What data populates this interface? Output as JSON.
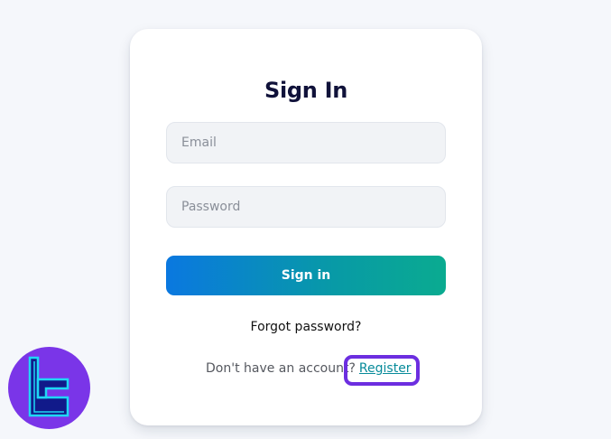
{
  "signin_form": {
    "title": "Sign In",
    "email_placeholder": "Email",
    "password_placeholder": "Password",
    "submit_label": "Sign in",
    "forgot_password": "Forgot password?",
    "register_prompt": "Don't have an account?",
    "register_link": "Register"
  },
  "colors": {
    "page_background": "#f5f7fb",
    "button_gradient_start": "#0a78e0",
    "button_gradient_end": "#0aab90",
    "register_link": "#078b9a",
    "highlight_outline": "#6c2ee0",
    "logo_background": "#7a35e8",
    "logo_stroke": "#1ed8f5"
  },
  "icons": {
    "brand_logo": "tc-monogram-logo"
  }
}
